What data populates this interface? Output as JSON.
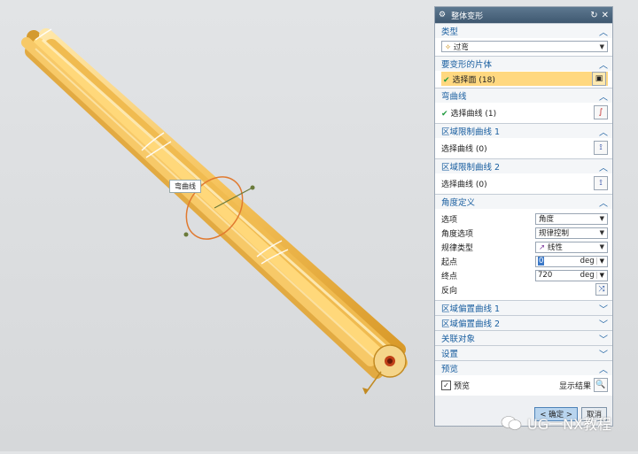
{
  "viewport": {
    "callout_label": "弯曲线"
  },
  "dialog": {
    "title": "整体变形",
    "sections": {
      "type": {
        "header": "类型",
        "value": "过弯"
      },
      "bodies": {
        "header": "要变形的片体",
        "select_label": "选择面 (18)"
      },
      "bend_curve": {
        "header": "弯曲线",
        "select_label": "选择曲线 (1)"
      },
      "limit1": {
        "header": "区域限制曲线 1",
        "select_label": "选择曲线 (0)"
      },
      "limit2": {
        "header": "区域限制曲线 2",
        "select_label": "选择曲线 (0)"
      },
      "angle": {
        "header": "角度定义",
        "option_label": "选项",
        "option_value": "角度",
        "angle_option_label": "角度选项",
        "angle_option_value": "规律控制",
        "law_type_label": "规律类型",
        "law_type_value": "线性",
        "start_label": "起点",
        "start_value": "0",
        "start_unit": "deg",
        "end_label": "终点",
        "end_value": "720",
        "end_unit": "deg",
        "reverse_label": "反向"
      },
      "offset1": {
        "header": "区域偏置曲线 1"
      },
      "offset2": {
        "header": "区域偏置曲线 2"
      },
      "associate": {
        "header": "关联对象"
      },
      "settings": {
        "header": "设置"
      },
      "preview": {
        "header": "预览",
        "preview_label": "预览",
        "show_result_label": "显示结果"
      }
    },
    "buttons": {
      "ok": "< 确定 >",
      "cancel": "取消"
    }
  },
  "watermark": "UG一NX教程",
  "colors": {
    "accent": "#1a5fa0",
    "highlight": "#ffd880",
    "tube": "#f5c25a"
  }
}
